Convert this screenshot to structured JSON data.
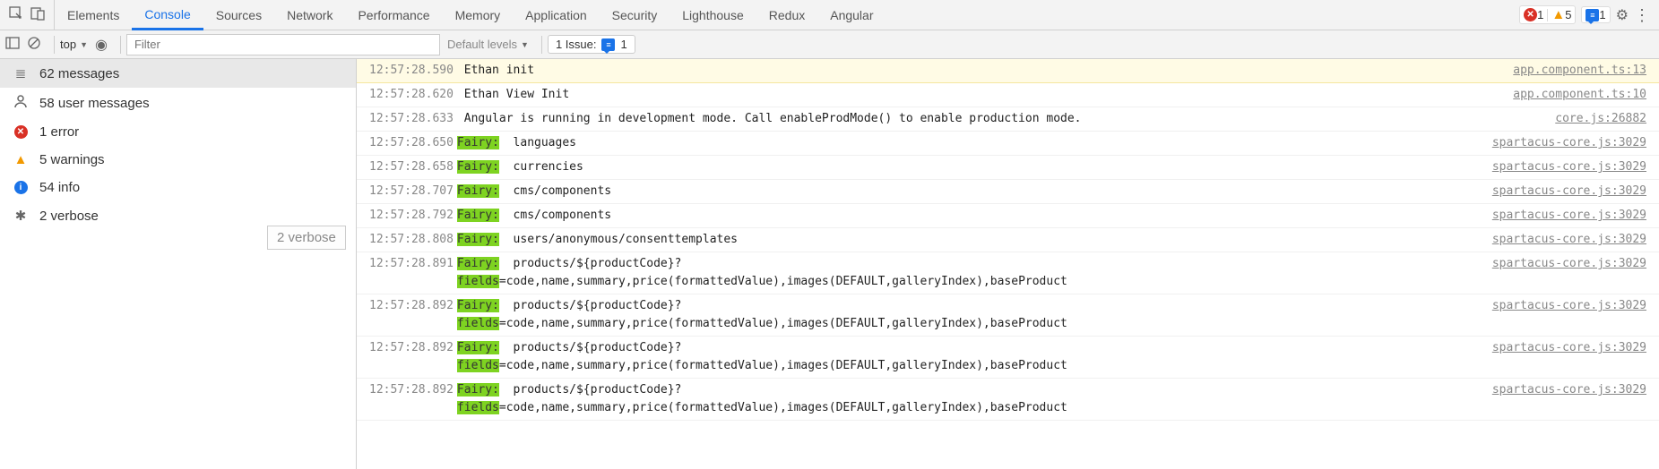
{
  "topbar": {
    "tabs": [
      "Elements",
      "Console",
      "Sources",
      "Network",
      "Performance",
      "Memory",
      "Application",
      "Security",
      "Lighthouse",
      "Redux",
      "Angular"
    ],
    "active_tab": "Console",
    "errors_count": "1",
    "warnings_count": "5",
    "messages_count": "1"
  },
  "toolbar": {
    "context": "top",
    "filter_placeholder": "Filter",
    "levels_label": "Default levels",
    "issues_label": "1 Issue:",
    "issues_count": "1"
  },
  "sidebar": {
    "rows": [
      {
        "icon": "list-icon",
        "label": "62 messages",
        "selected": true
      },
      {
        "icon": "user-icon",
        "label": "58 user messages"
      },
      {
        "icon": "circle-err",
        "label": "1 error"
      },
      {
        "icon": "tri-warn",
        "label": "5 warnings"
      },
      {
        "icon": "circle-info",
        "label": "54 info"
      },
      {
        "icon": "bug",
        "label": "2 verbose"
      }
    ],
    "tooltip": "2 verbose"
  },
  "logs": [
    {
      "ts": "12:57:28.590",
      "msg": "Ethan init",
      "src": "app.component.ts:13",
      "warn": true
    },
    {
      "ts": "12:57:28.620",
      "msg": "Ethan View Init",
      "src": "app.component.ts:10"
    },
    {
      "ts": "12:57:28.633",
      "msg": "Angular is running in development mode. Call enableProdMode() to enable production mode.",
      "src": "core.js:26882"
    },
    {
      "ts": "12:57:28.650",
      "fairy": "Fairy:",
      "msg": "  languages",
      "src": "spartacus-core.js:3029"
    },
    {
      "ts": "12:57:28.658",
      "fairy": "Fairy:",
      "msg": "  currencies",
      "src": "spartacus-core.js:3029"
    },
    {
      "ts": "12:57:28.707",
      "fairy": "Fairy:",
      "msg": "  cms/components",
      "src": "spartacus-core.js:3029"
    },
    {
      "ts": "12:57:28.792",
      "fairy": "Fairy:",
      "msg": "  cms/components",
      "src": "spartacus-core.js:3029"
    },
    {
      "ts": "12:57:28.808",
      "fairy": "Fairy:",
      "msg": "  users/anonymous/consenttemplates",
      "src": "spartacus-core.js:3029"
    },
    {
      "ts": "12:57:28.891",
      "fairy": "Fairy:",
      "msg": "  products/${productCode}?",
      "msg2_hl": "fields",
      "msg2": "=code,name,summary,price(formattedValue),images(DEFAULT,galleryIndex),baseProduct",
      "src": "spartacus-core.js:3029"
    },
    {
      "ts": "12:57:28.892",
      "fairy": "Fairy:",
      "msg": "  products/${productCode}?",
      "msg2_hl": "fields",
      "msg2": "=code,name,summary,price(formattedValue),images(DEFAULT,galleryIndex),baseProduct",
      "src": "spartacus-core.js:3029"
    },
    {
      "ts": "12:57:28.892",
      "fairy": "Fairy:",
      "msg": "  products/${productCode}?",
      "msg2_hl": "fields",
      "msg2": "=code,name,summary,price(formattedValue),images(DEFAULT,galleryIndex),baseProduct",
      "src": "spartacus-core.js:3029"
    },
    {
      "ts": "12:57:28.892",
      "fairy": "Fairy:",
      "msg": "  products/${productCode}?",
      "msg2_hl": "fields",
      "msg2": "=code,name,summary,price(formattedValue),images(DEFAULT,galleryIndex),baseProduct",
      "src": "spartacus-core.js:3029"
    }
  ]
}
